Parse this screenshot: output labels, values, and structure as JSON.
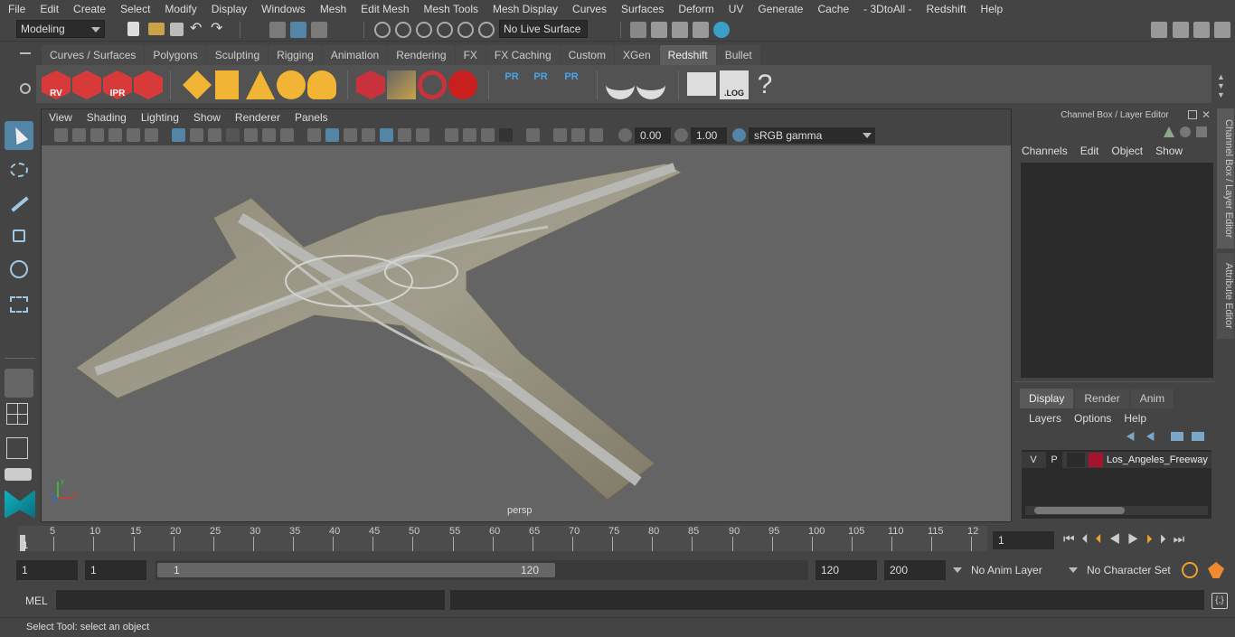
{
  "menu": [
    "File",
    "Edit",
    "Create",
    "Select",
    "Modify",
    "Display",
    "Windows",
    "Mesh",
    "Edit Mesh",
    "Mesh Tools",
    "Mesh Display",
    "Curves",
    "Surfaces",
    "Deform",
    "UV",
    "Generate",
    "Cache",
    "- 3DtoAll -",
    "Redshift",
    "Help"
  ],
  "status": {
    "mode": "Modeling",
    "live_surface": "No Live Surface"
  },
  "shelf": {
    "tabs": [
      "Curves / Surfaces",
      "Polygons",
      "Sculpting",
      "Rigging",
      "Animation",
      "Rendering",
      "FX",
      "FX Caching",
      "Custom",
      "XGen",
      "Redshift",
      "Bullet"
    ],
    "active": "Redshift",
    "icon_labels": {
      "rv": "RV",
      "ipr": "IPR",
      "pr": "PR",
      "log": ".LOG",
      "help": "?"
    }
  },
  "viewport": {
    "menu": [
      "View",
      "Shading",
      "Lighting",
      "Show",
      "Renderer",
      "Panels"
    ],
    "exposure": "0.00",
    "gamma": "1.00",
    "color_space": "sRGB gamma",
    "camera": "persp",
    "axis": {
      "x": "x",
      "y": "y",
      "z": "z"
    }
  },
  "channel_box": {
    "title": "Channel Box / Layer Editor",
    "menu": [
      "Channels",
      "Edit",
      "Object",
      "Show"
    ]
  },
  "layer_editor": {
    "tabs": [
      "Display",
      "Render",
      "Anim"
    ],
    "active": "Display",
    "menu": [
      "Layers",
      "Options",
      "Help"
    ],
    "layers": [
      {
        "v": "V",
        "p": "P",
        "color": "#a3142e",
        "name": "Los_Angeles_Freeway"
      }
    ]
  },
  "side_tabs": [
    "Channel Box / Layer Editor",
    "Attribute Editor"
  ],
  "timeline": {
    "ticks": [
      "5",
      "10",
      "15",
      "20",
      "25",
      "30",
      "35",
      "40",
      "45",
      "50",
      "55",
      "60",
      "65",
      "70",
      "75",
      "80",
      "85",
      "90",
      "95",
      "100",
      "105",
      "110",
      "115",
      "12"
    ],
    "start_marker": "1",
    "current_frame": "1"
  },
  "range": {
    "start": "1",
    "anim_start": "1",
    "slider_start": "1",
    "slider_end": "120",
    "anim_end": "120",
    "end": "200",
    "anim_layer": "No Anim Layer",
    "character_set": "No Character Set"
  },
  "mel": {
    "label": "MEL"
  },
  "help_line": "Select Tool: select an object",
  "colors": {
    "accent": "#5285a6",
    "layer": "#a3142e",
    "redshift": "#d32f2f"
  }
}
